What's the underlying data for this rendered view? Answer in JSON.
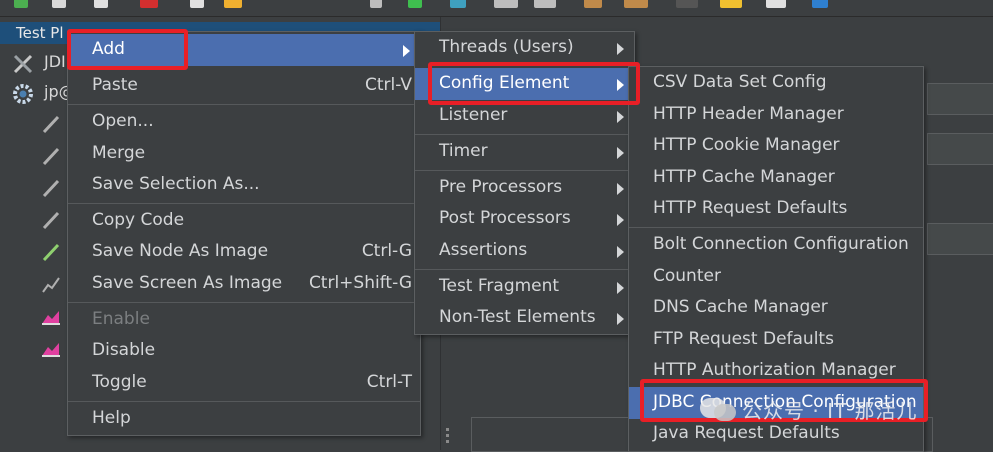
{
  "tree": {
    "header_label": "Test Pl",
    "items": [
      {
        "label": "JDI",
        "icon": "tools-icon"
      },
      {
        "label": "jp@",
        "icon": "gear-icon"
      },
      {
        "label": "",
        "icon": "pipette-icon"
      },
      {
        "label": "",
        "icon": "pipette-icon"
      },
      {
        "label": "",
        "icon": "pipette-icon"
      },
      {
        "label": "",
        "icon": "pipette-icon"
      },
      {
        "label": "",
        "icon": "pipette-green-icon"
      },
      {
        "label": "",
        "icon": "chart-icon"
      },
      {
        "label": "",
        "icon": "graph-icon"
      },
      {
        "label": "",
        "icon": "graph-icon"
      }
    ]
  },
  "context_menu": {
    "items": [
      {
        "label": "Add",
        "shortcut": "",
        "submenu": true,
        "selected": true
      },
      {
        "label": "Paste",
        "shortcut": "Ctrl-V"
      },
      {
        "label": "Open...",
        "shortcut": ""
      },
      {
        "label": "Merge",
        "shortcut": ""
      },
      {
        "label": "Save Selection As...",
        "shortcut": ""
      },
      {
        "label": "Copy Code",
        "shortcut": ""
      },
      {
        "label": "Save Node As Image",
        "shortcut": "Ctrl-G"
      },
      {
        "label": "Save Screen As Image",
        "shortcut": "Ctrl+Shift-G"
      },
      {
        "label": "Enable",
        "shortcut": "",
        "disabled": true
      },
      {
        "label": "Disable",
        "shortcut": ""
      },
      {
        "label": "Toggle",
        "shortcut": "Ctrl-T"
      },
      {
        "label": "Help",
        "shortcut": ""
      }
    ]
  },
  "add_submenu": {
    "items": [
      {
        "label": "Threads (Users)"
      },
      {
        "label": "Config Element",
        "selected": true
      },
      {
        "label": "Listener"
      },
      {
        "label": "Timer"
      },
      {
        "label": "Pre Processors"
      },
      {
        "label": "Post Processors"
      },
      {
        "label": "Assertions"
      },
      {
        "label": "Test Fragment"
      },
      {
        "label": "Non-Test Elements"
      }
    ]
  },
  "config_submenu": {
    "items": [
      {
        "label": "CSV Data Set Config"
      },
      {
        "label": "HTTP Header Manager"
      },
      {
        "label": "HTTP Cookie Manager"
      },
      {
        "label": "HTTP Cache Manager"
      },
      {
        "label": "HTTP Request Defaults"
      },
      {
        "label": "Bolt Connection Configuration"
      },
      {
        "label": "Counter"
      },
      {
        "label": "DNS Cache Manager"
      },
      {
        "label": "FTP Request Defaults"
      },
      {
        "label": "HTTP Authorization Manager"
      },
      {
        "label": "JDBC Connection Configuration",
        "selected": true
      },
      {
        "label": "Java Request Defaults"
      }
    ]
  },
  "watermark": {
    "text": "公众号 · IT 那活儿"
  },
  "colors": {
    "selection": "#4b6eaf",
    "highlight_box": "#e81f26",
    "menu_bg": "#3c3f41",
    "tree_header": "#1e4f7a"
  }
}
